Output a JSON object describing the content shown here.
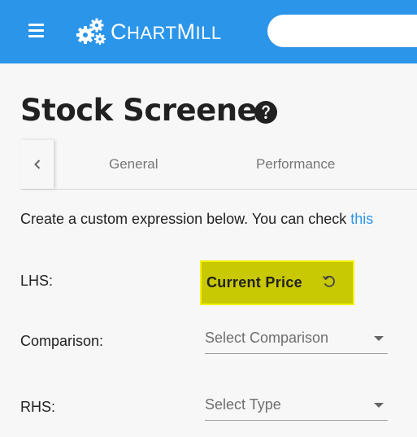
{
  "header": {
    "brand": "ChartMill",
    "search_placeholder": "",
    "colors": {
      "header_bg": "#2b95ea",
      "highlight": "#c8c803",
      "link": "#2b95ea"
    }
  },
  "page": {
    "title": "Stock Screener"
  },
  "tabs": [
    "General",
    "Performance"
  ],
  "intro": {
    "text": "Create a custom expression below. You can check ",
    "link": "this"
  },
  "form": {
    "lhs": {
      "label": "LHS:",
      "value": "Current Price"
    },
    "comparison": {
      "label": "Comparison:",
      "placeholder": "Select Comparison"
    },
    "rhs": {
      "label": "RHS:",
      "placeholder": "Select Type"
    }
  },
  "icons": [
    "menu-icon",
    "chartmill-gears-logo",
    "help-icon",
    "chevron-left-icon",
    "reset-icon",
    "caret-down-icon"
  ]
}
